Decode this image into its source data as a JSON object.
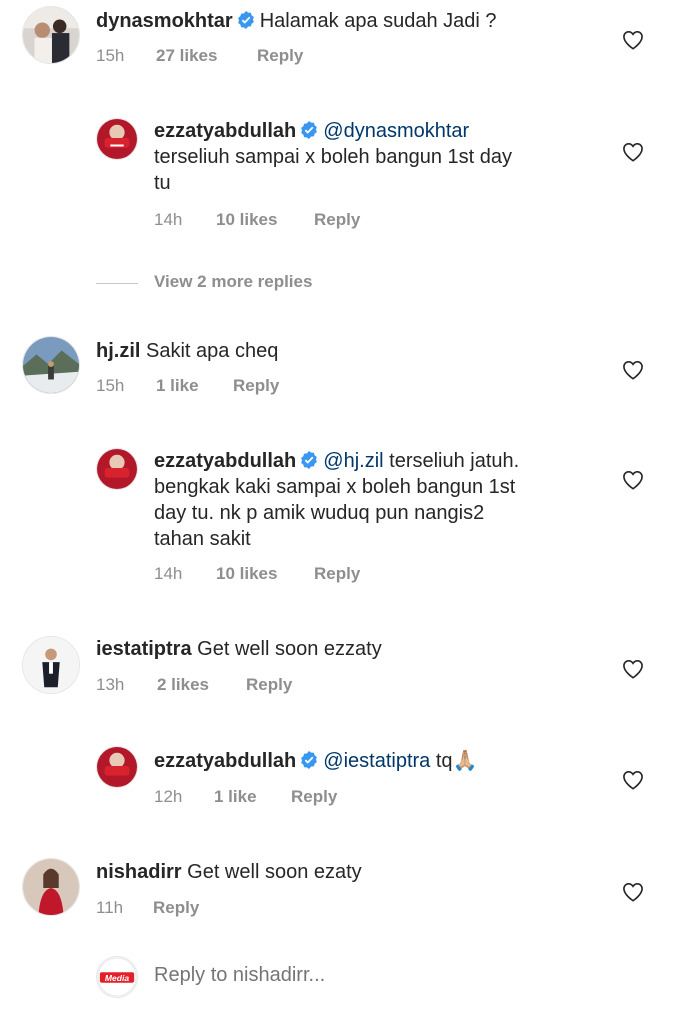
{
  "comments": [
    {
      "username": "dynasmokhtar",
      "verified": true,
      "text": "Halamak apa sudah Jadi ?",
      "time": "15h",
      "likes": "27 likes",
      "reply": "Reply",
      "avatar_icon": "avatar-dynasmokhtar",
      "replies": [
        {
          "username": "ezzatyabdullah",
          "verified": true,
          "mention": "@dynasmokhtar",
          "line1": "",
          "line2": "terseliuh sampai x boleh bangun 1st day",
          "line3": "tu",
          "time": "14h",
          "likes": "10 likes",
          "reply": "Reply"
        }
      ],
      "view_more": "View 2 more replies"
    },
    {
      "username": "hj.zil",
      "text": "Sakit apa cheq",
      "time": "15h",
      "likes": "1 like",
      "reply": "Reply",
      "replies": [
        {
          "username": "ezzatyabdullah",
          "verified": true,
          "mention": "@hj.zil",
          "line1": "terseliuh jatuh.",
          "line2": "bengkak kaki sampai x boleh bangun 1st",
          "line3": "day tu. nk p amik wuduq pun nangis2",
          "line4": "tahan sakit",
          "time": "14h",
          "likes": "10 likes",
          "reply": "Reply"
        }
      ]
    },
    {
      "username": "iestatiptra",
      "text": "Get well soon ezzaty",
      "time": "13h",
      "likes": "2 likes",
      "reply": "Reply",
      "replies": [
        {
          "username": "ezzatyabdullah",
          "verified": true,
          "mention": "@iestatiptra",
          "line1": "tq🙏🏼",
          "time": "12h",
          "likes": "1 like",
          "reply": "Reply"
        }
      ]
    },
    {
      "username": "nishadirr",
      "text": "Get well soon ezaty",
      "time": "11h",
      "reply": "Reply"
    }
  ],
  "reply_bar": {
    "placeholder": "Reply to nishadirr...",
    "avatar_label": "Media"
  },
  "colors": {
    "text": "#262626",
    "secondary": "#8e8e8e",
    "mention": "#00376b",
    "verified": "#3897f0"
  }
}
